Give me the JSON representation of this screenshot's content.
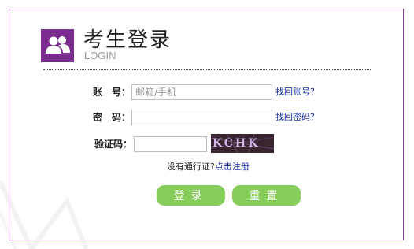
{
  "header": {
    "title": "考生登录",
    "subtitle": "LOGIN",
    "logo_icon": "users-icon",
    "logo_color": "#7b2c8f"
  },
  "form": {
    "account_label": "账　号：",
    "account_placeholder": "邮箱/手机",
    "account_value": "",
    "recover_account_link": "找回账号？",
    "password_label": "密　码：",
    "password_value": "",
    "recover_password_link": "找回密码？",
    "captcha_label": "验证码：",
    "captcha_value": "",
    "captcha_text": "KCHK"
  },
  "register": {
    "prompt": "没有通行证?",
    "link": "点击注册"
  },
  "buttons": {
    "login": "登录",
    "reset": "重置",
    "color": "#86cc5a"
  },
  "colors": {
    "border": "#8a3f98",
    "link": "#1b2fa8"
  }
}
